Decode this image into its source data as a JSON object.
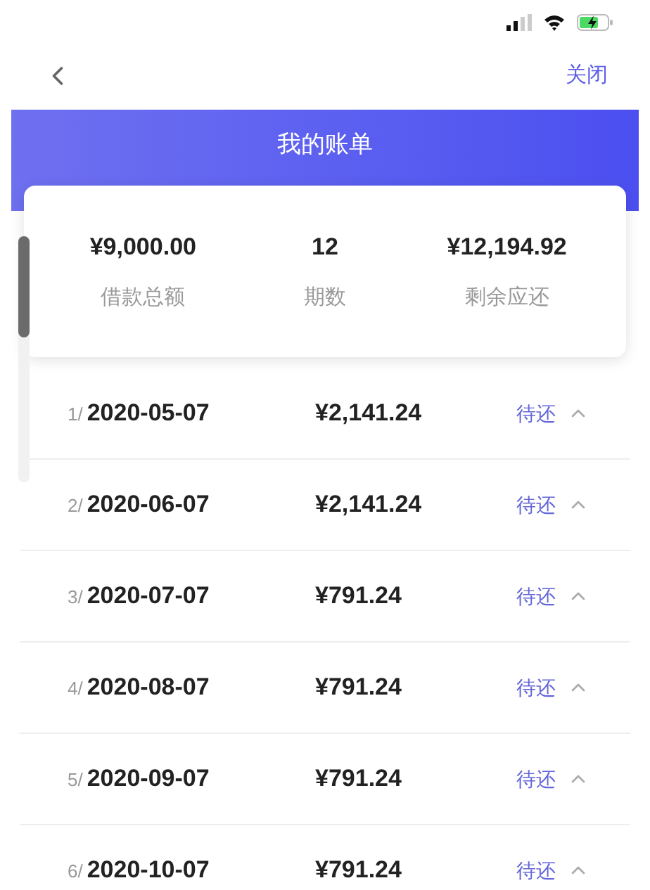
{
  "nav": {
    "close": "关闭"
  },
  "header": {
    "title": "我的账单"
  },
  "summary": [
    {
      "value": "¥9,000.00",
      "label": "借款总额"
    },
    {
      "value": "12",
      "label": "期数"
    },
    {
      "value": "¥12,194.92",
      "label": "剩余应还"
    }
  ],
  "installments": [
    {
      "index": "1/",
      "date": "2020-05-07",
      "amount": "¥2,141.24",
      "status": "待还"
    },
    {
      "index": "2/",
      "date": "2020-06-07",
      "amount": "¥2,141.24",
      "status": "待还"
    },
    {
      "index": "3/",
      "date": "2020-07-07",
      "amount": "¥791.24",
      "status": "待还"
    },
    {
      "index": "4/",
      "date": "2020-08-07",
      "amount": "¥791.24",
      "status": "待还"
    },
    {
      "index": "5/",
      "date": "2020-09-07",
      "amount": "¥791.24",
      "status": "待还"
    },
    {
      "index": "6/",
      "date": "2020-10-07",
      "amount": "¥791.24",
      "status": "待还"
    }
  ]
}
